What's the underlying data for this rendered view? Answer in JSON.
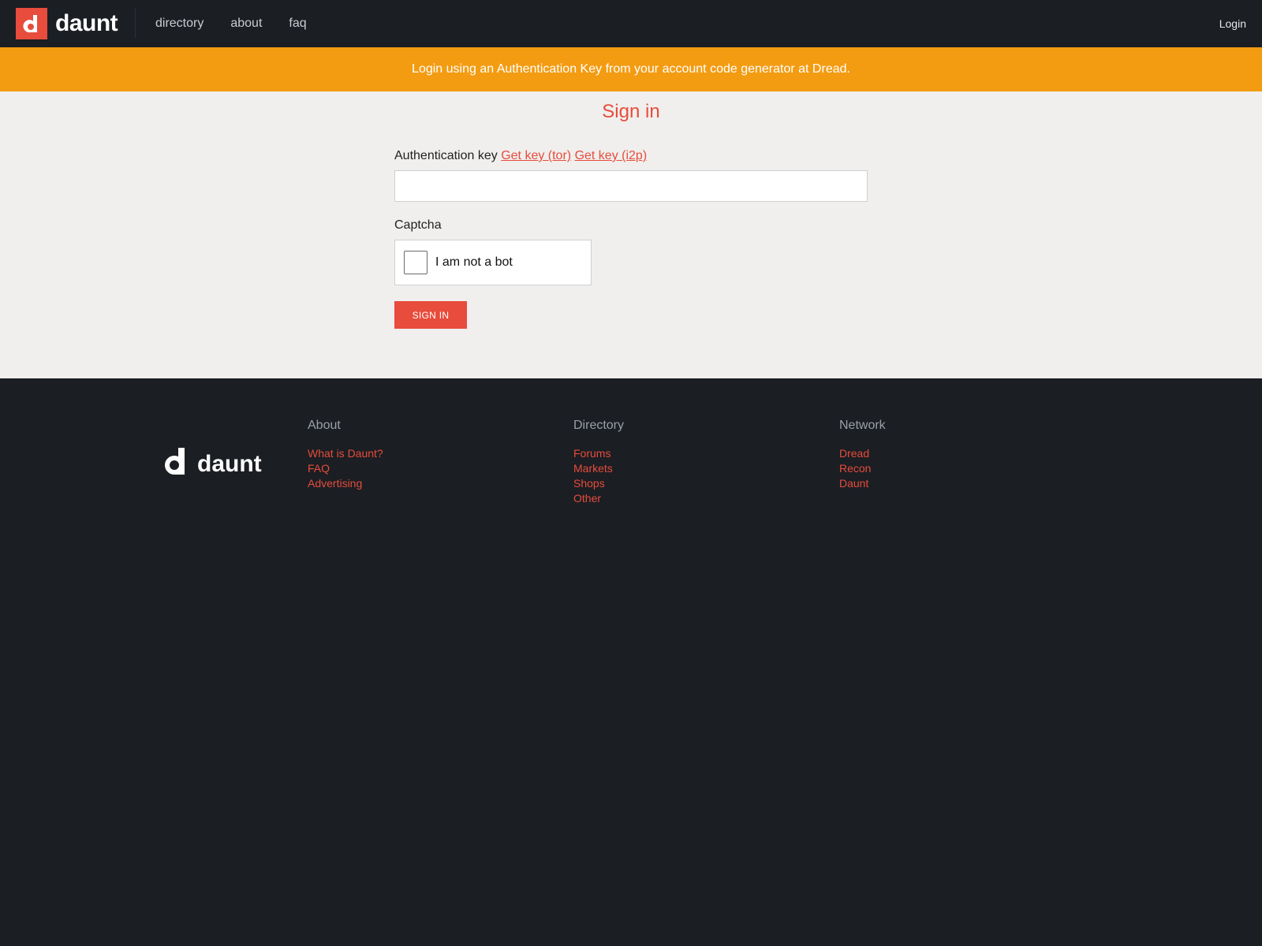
{
  "header": {
    "brand": "daunt",
    "nav": [
      "directory",
      "about",
      "faq"
    ],
    "login": "Login"
  },
  "banner": {
    "text": "Login using an Authentication Key from your account code generator at Dread."
  },
  "main": {
    "title": "Sign in",
    "auth_label": "Authentication key",
    "get_key_tor": "Get key (tor)",
    "get_key_i2p": "Get key (i2p)",
    "auth_value": "",
    "captcha_label": "Captcha",
    "captcha_text": "I am not a bot",
    "submit": "SIGN IN"
  },
  "footer": {
    "brand": "daunt",
    "columns": [
      {
        "title": "About",
        "links": [
          "What is Daunt?",
          "FAQ",
          "Advertising"
        ]
      },
      {
        "title": "Directory",
        "links": [
          "Forums",
          "Markets",
          "Shops",
          "Other"
        ]
      },
      {
        "title": "Network",
        "links": [
          "Dread",
          "Recon",
          "Daunt"
        ]
      }
    ]
  },
  "colors": {
    "accent": "#e74c3c",
    "banner": "#f39c12",
    "dark": "#1b1e23",
    "main_bg": "#f0efed"
  },
  "icons": {
    "brand_mark": "daunt-logo-icon",
    "captcha": "checkbox-icon"
  }
}
